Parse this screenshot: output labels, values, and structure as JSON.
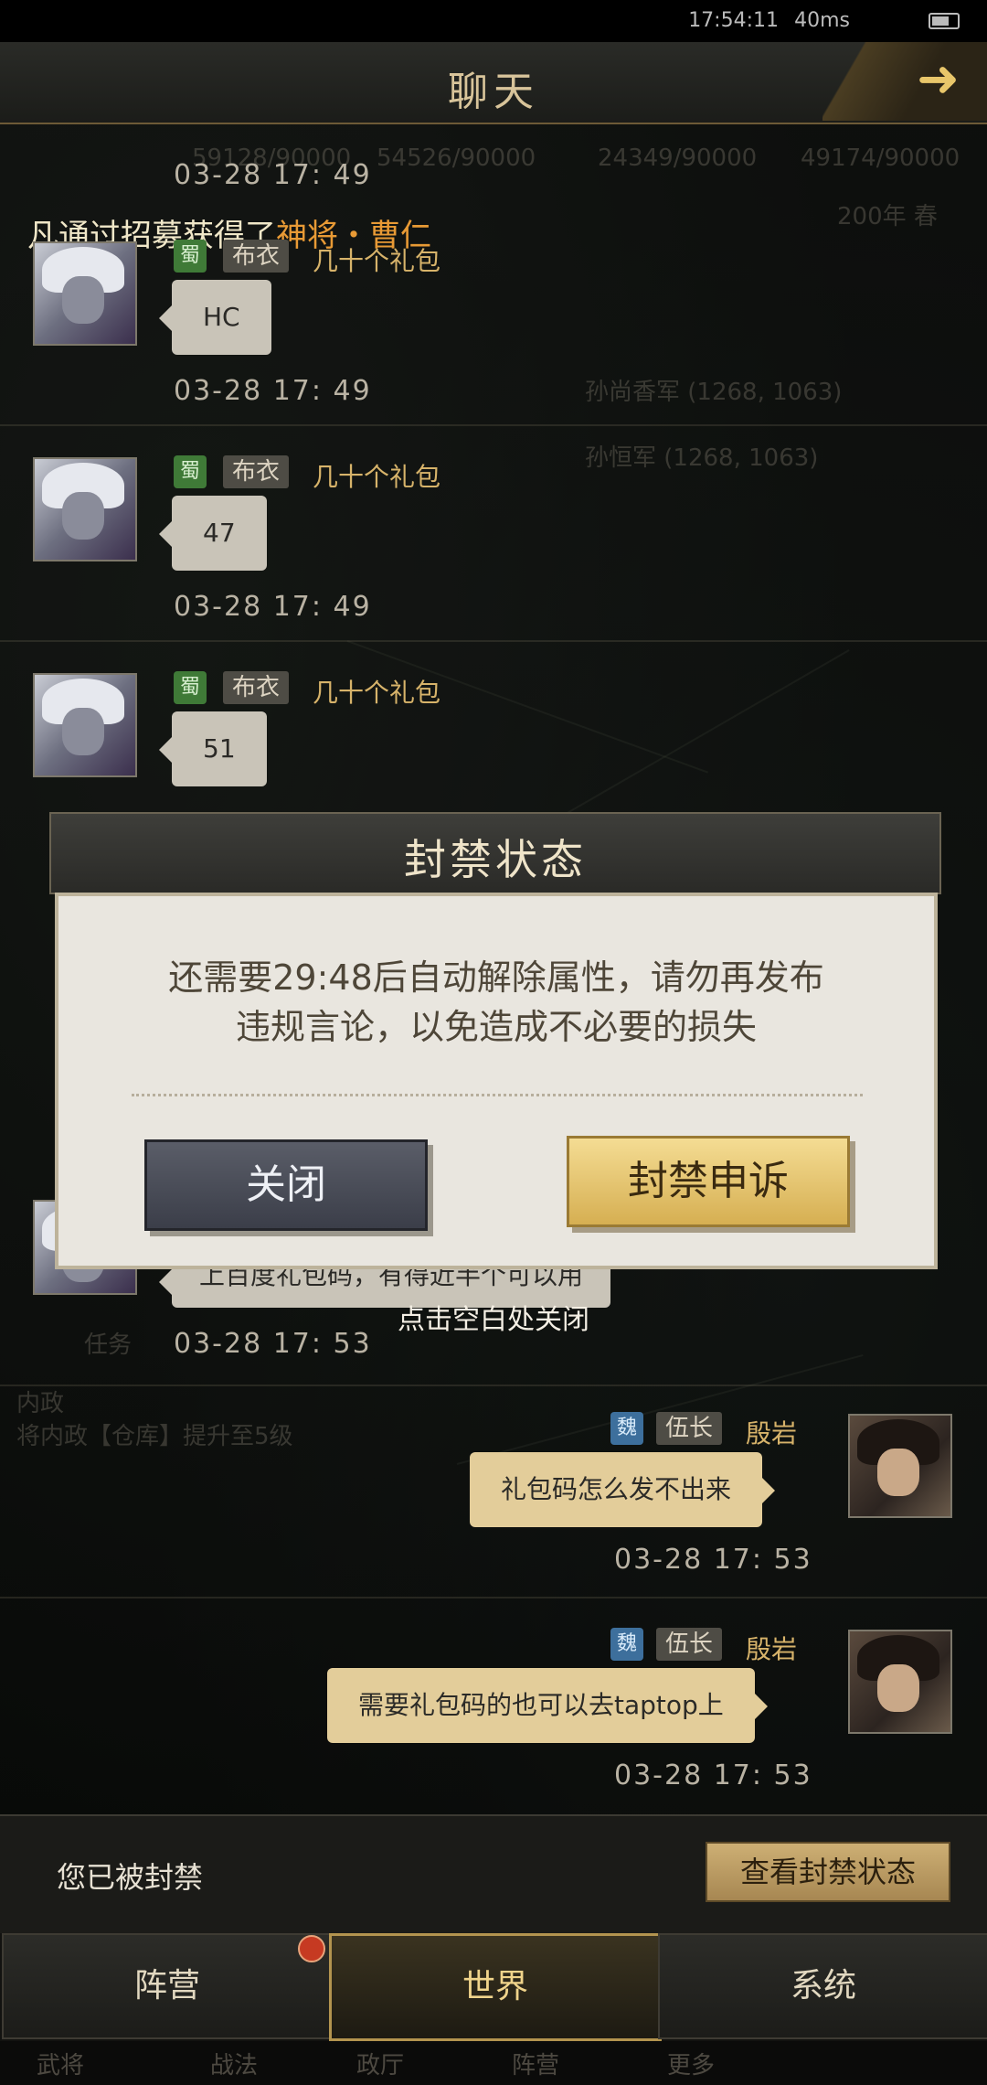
{
  "status_bar": {
    "time": "17:54:11",
    "net": "40ms"
  },
  "header": {
    "title": "聊天"
  },
  "background_overlay": {
    "res1": "59128/90000",
    "res2": "54526/90000",
    "res3": "24349/90000",
    "res4": "49174/90000",
    "season": "200年 春",
    "task": "任务",
    "inner": "内政",
    "inner_desc": "将内政【仓库】提升至5级",
    "loc1": "孙尚香军 (1268, 1063)",
    "loc2": "孙恒军 (1268, 1063)",
    "bottom_nav": [
      "武将",
      "战法",
      "政厅",
      "阵营",
      "更多"
    ]
  },
  "system_line": {
    "prefix": "凡通过招募获得了",
    "highlight": "神将・曹仁"
  },
  "messages": [
    {
      "time": "03-28 17: 49",
      "badge": "蜀",
      "rank": "布衣",
      "name": "几十个礼包",
      "text": "HC"
    },
    {
      "time": "03-28 17: 49",
      "badge": "蜀",
      "rank": "布衣",
      "name": "几十个礼包",
      "text": "47"
    },
    {
      "time": "03-28 17: 49",
      "badge": "蜀",
      "rank": "布衣",
      "name": "几十个礼包",
      "text": "51"
    },
    {
      "partial_text": "上百度礼包码，有得近半个可以用",
      "time": "03-28 17: 53"
    },
    {
      "time": "03-28 17: 53",
      "badge": "魏",
      "rank": "伍长",
      "name": "殷岩",
      "text": "礼包码怎么发不出来"
    },
    {
      "time": "03-28 17: 53",
      "badge": "魏",
      "rank": "伍长",
      "name": "殷岩",
      "text": "需要礼包码的也可以去taptop上"
    }
  ],
  "ban_bar": {
    "text": "您已被封禁",
    "button": "查看封禁状态"
  },
  "tabs": [
    "阵营",
    "世界",
    "系统"
  ],
  "modal": {
    "title": "封禁状态",
    "line1": "还需要29:48后自动解除属性，请勿再发布",
    "line2": "违规言论，以免造成不必要的损失",
    "close": "关闭",
    "appeal": "封禁申诉"
  },
  "hint": "点击空白处关闭",
  "colors": {
    "accent_gold": "#d7b36a",
    "shu_green": "#3f7a37",
    "wei_blue": "#3d6f9c",
    "alert_red": "#c63a22"
  }
}
